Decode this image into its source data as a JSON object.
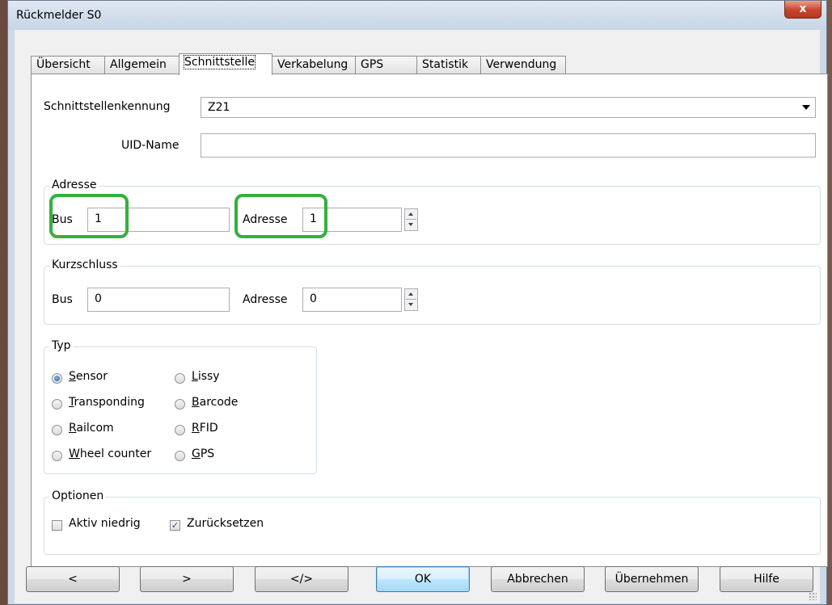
{
  "window": {
    "title": "Rückmelder S0",
    "close_label": "x"
  },
  "tabs": [
    {
      "label": "Übersicht"
    },
    {
      "label": "Allgemein"
    },
    {
      "label": "Schnittstelle"
    },
    {
      "label": "Verkabelung"
    },
    {
      "label": "GPS"
    },
    {
      "label": "Statistik"
    },
    {
      "label": "Verwendung"
    }
  ],
  "active_tab": "Schnittstelle",
  "interface": {
    "id_label": "Schnittstellenkennung",
    "id_value": "Z21",
    "uid_label": "UID-Name",
    "uid_value": ""
  },
  "adresse": {
    "title": "Adresse",
    "bus_label": "Bus",
    "bus_value": "1",
    "adresse_label": "Adresse",
    "adresse_value": "1"
  },
  "kurzschluss": {
    "title": "Kurzschluss",
    "bus_label": "Bus",
    "bus_value": "0",
    "adresse_label": "Adresse",
    "adresse_value": "0"
  },
  "typ": {
    "title": "Typ",
    "options": [
      {
        "key": "S",
        "rest": "ensor",
        "selected": true
      },
      {
        "key": "T",
        "rest": "ransponding",
        "selected": false
      },
      {
        "key": "R",
        "rest": "ailcom",
        "selected": false
      },
      {
        "key": "W",
        "rest": "heel counter",
        "selected": false
      },
      {
        "key": "L",
        "rest": "issy",
        "selected": false
      },
      {
        "key": "B",
        "rest": "arcode",
        "selected": false
      },
      {
        "key": "R",
        "rest": "FID",
        "selected": false
      },
      {
        "key": "G",
        "rest": "PS",
        "selected": false
      }
    ]
  },
  "optionen": {
    "title": "Optionen",
    "aktiv_niedrig": {
      "label": "Aktiv niedrig",
      "checked": false
    },
    "zuruecksetzen": {
      "label": "Zurücksetzen",
      "checked": true
    }
  },
  "buttons": {
    "prev": "<",
    "next": ">",
    "code": "</>",
    "ok": "OK",
    "cancel": "Abbrechen",
    "apply": "Übernehmen",
    "help": "Hilfe"
  },
  "colors": {
    "highlight": "#34b03c",
    "close_button": "#c7432b",
    "radio_selected": "#1f5fb4"
  }
}
